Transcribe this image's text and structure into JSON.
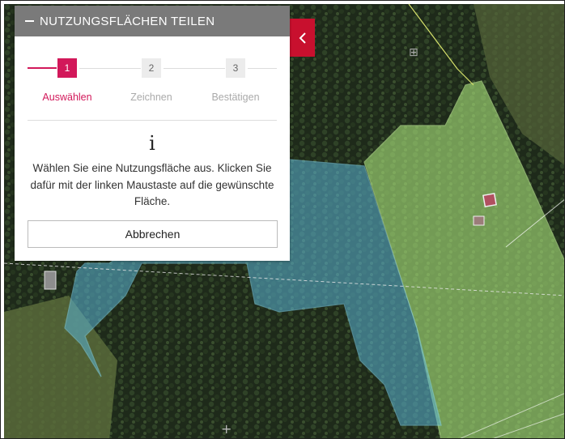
{
  "panel": {
    "title": "NUTZUNGSFLÄCHEN TEILEN",
    "steps": [
      {
        "number": "1",
        "label": "Auswählen"
      },
      {
        "number": "2",
        "label": "Zeichnen"
      },
      {
        "number": "3",
        "label": "Bestätigen"
      }
    ],
    "active_step": "1",
    "info_glyph": "i",
    "instruction": "Wählen Sie eine Nutzungsfläche aus. Klicken Sie dafür mit der linken Maustaste auf die gewünschte Fläche.",
    "cancel_label": "Abbrechen"
  },
  "colors": {
    "header": "#7a7a7a",
    "accent": "#d2185a",
    "collapse_tab": "#c8102e",
    "parcel_blue": "#5ab4d6",
    "parcel_green": "#a8e07a"
  },
  "icons": {
    "collapse": "minus-icon",
    "side_toggle": "chevron-left-icon",
    "info": "info-icon"
  }
}
